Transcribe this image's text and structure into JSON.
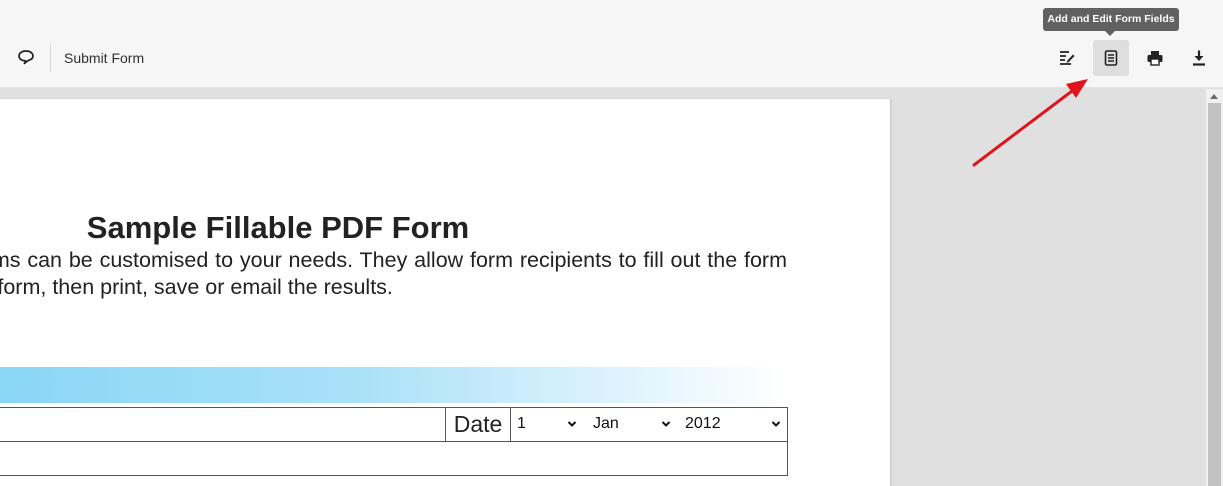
{
  "toolbar": {
    "submit_label": "Submit Form",
    "tooltip": "Add and Edit Form Fields",
    "icons": {
      "comment": "comment-icon",
      "edit_sign": "edit-sign-icon",
      "form_fields": "form-fields-icon",
      "print": "printer-icon",
      "download": "download-icon"
    }
  },
  "document": {
    "title": "Sample Fillable PDF Form",
    "paragraph": "Fillable PDF forms can be customised to your needs. They allow form recipients to fill out the form like a web page form, then print, save or email the results.",
    "date_label": "Date",
    "day": "1",
    "month": "Jan",
    "year": "2012"
  },
  "colors": {
    "accent_blue": "#8ad6f5",
    "annotation_red": "#e0141b",
    "tooltip_bg": "#616161"
  }
}
